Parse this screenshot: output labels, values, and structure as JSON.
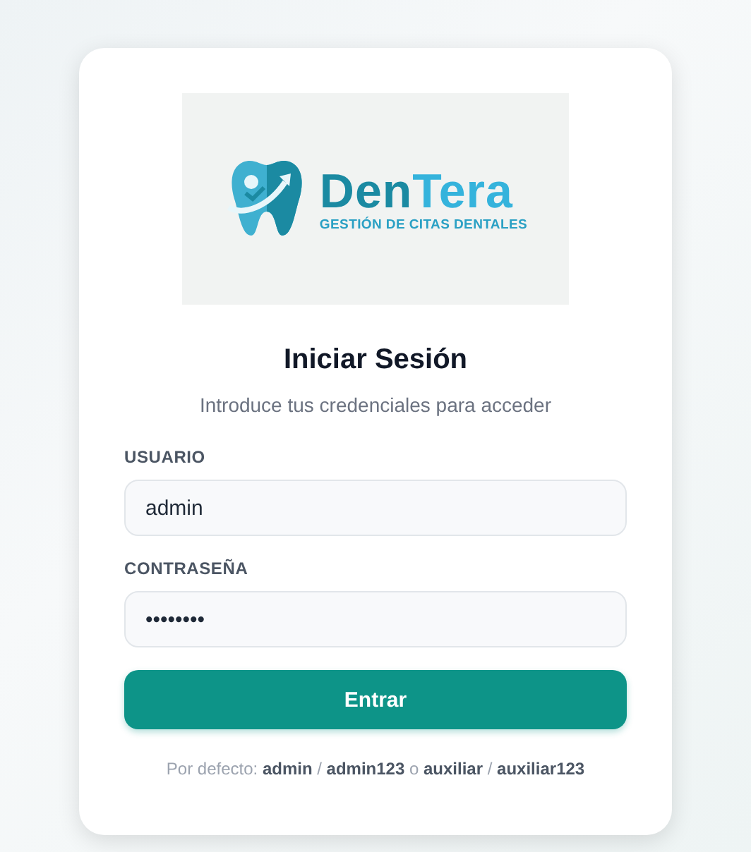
{
  "logo": {
    "brand_first": "Den",
    "brand_second": "Tera",
    "tagline": "GESTIÓN DE CITAS DENTALES"
  },
  "title": "Iniciar Sesión",
  "subtitle": "Introduce tus credenciales para acceder",
  "fields": [
    {
      "label": "USUARIO",
      "value": "admin"
    },
    {
      "label": "CONTRASEÑA",
      "value": "••••••••"
    }
  ],
  "submit": "Entrar",
  "hint": "Por defecto: **admin** / **admin123** o **auxiliar** / **auxiliar123**"
}
